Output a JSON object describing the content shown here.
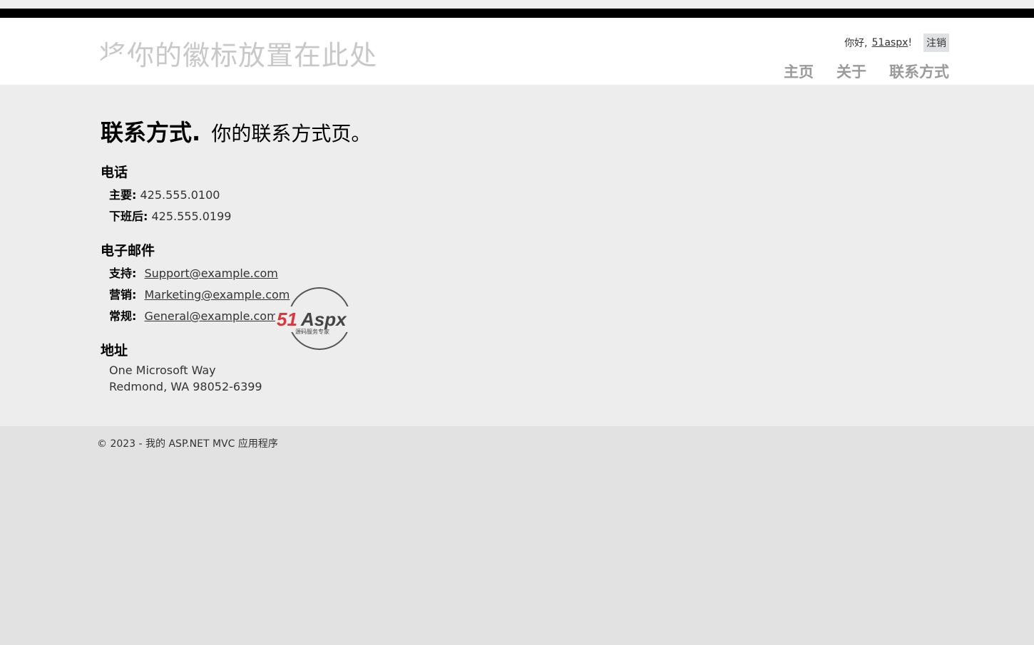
{
  "header": {
    "site_title": "将你的徽标放置在此处",
    "greeting": "你好,",
    "username": "51aspx",
    "exclamation": "!",
    "logout_label": "注销",
    "nav": [
      "主页",
      "关于",
      "联系方式"
    ]
  },
  "page": {
    "title": "联系方式.",
    "subtitle": "你的联系方式页。"
  },
  "phone": {
    "heading": "电话",
    "items": [
      {
        "label": "主要:",
        "value": "425.555.0100"
      },
      {
        "label": "下班后:",
        "value": "425.555.0199"
      }
    ]
  },
  "email": {
    "heading": "电子邮件",
    "items": [
      {
        "label": "支持:",
        "value": "Support@example.com"
      },
      {
        "label": "营销:",
        "value": "Marketing@example.com"
      },
      {
        "label": "常规:",
        "value": "General@example.com"
      }
    ]
  },
  "address": {
    "heading": "地址",
    "line1": "One Microsoft Way",
    "line2": "Redmond, WA 98052-6399"
  },
  "watermark": {
    "brand_number": "51",
    "brand_text": "Aspx",
    "tagline": "源码服务专家"
  },
  "footer": {
    "copyright": "© 2023 - 我的 ASP.NET MVC 应用程序"
  },
  "colors": {
    "accent_dark": "#000000",
    "nav_gray": "#9a9a9a",
    "body_bg": "#ededed",
    "footer_bg": "#e2e2e2"
  }
}
